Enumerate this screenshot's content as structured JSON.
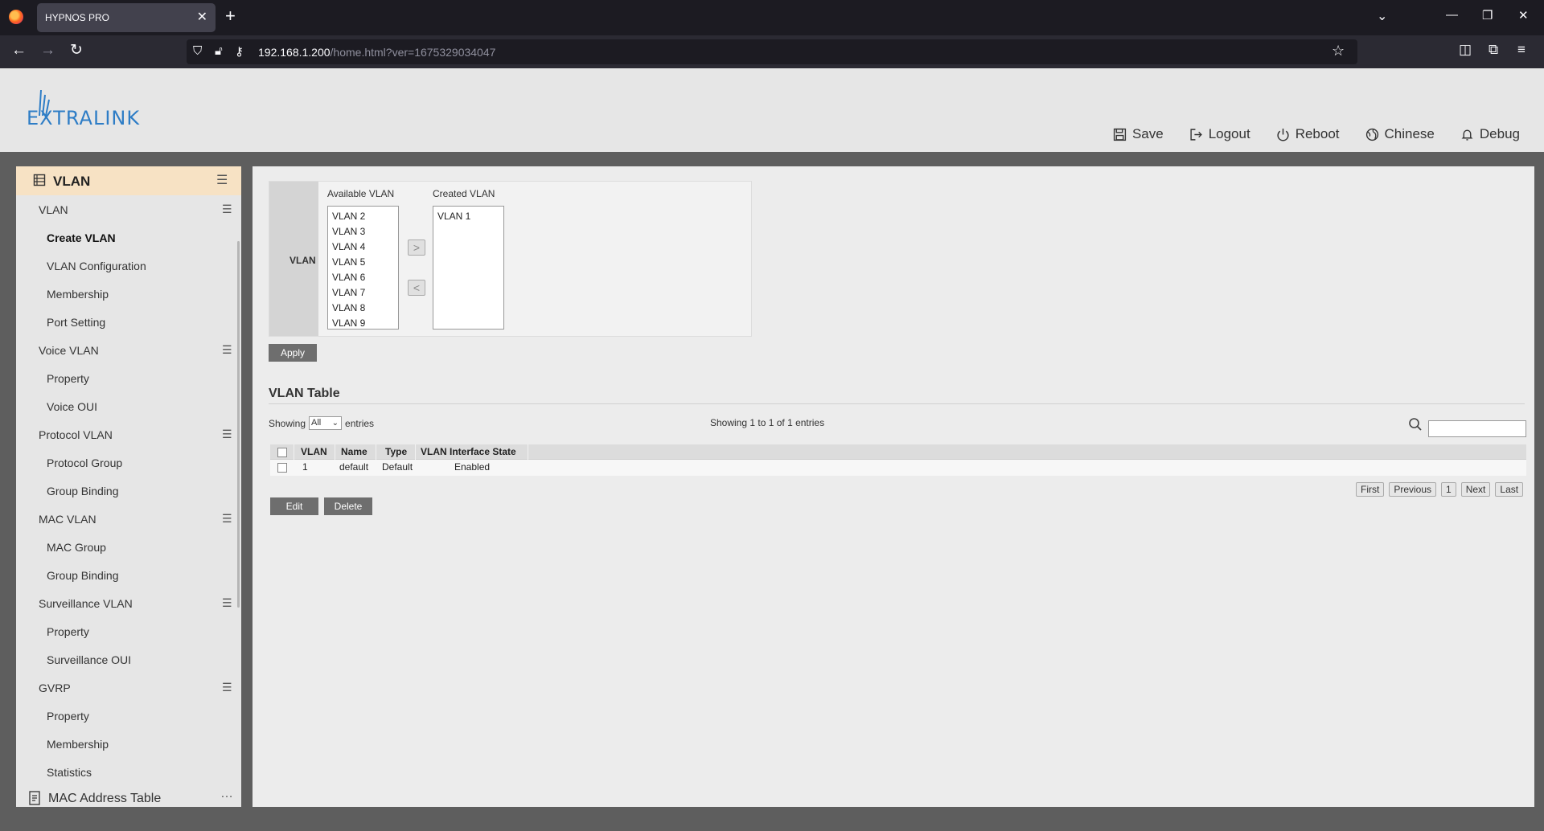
{
  "browser": {
    "tab_title": "HYPNOS PRO",
    "url_host": "192.168.1.200",
    "url_path": "/home.html?ver=1675329034047"
  },
  "header": {
    "logo_text": "EXTRALINK",
    "menu": [
      {
        "label": "Save",
        "icon": "save-icon"
      },
      {
        "label": "Logout",
        "icon": "logout-icon"
      },
      {
        "label": "Reboot",
        "icon": "power-icon"
      },
      {
        "label": "Chinese",
        "icon": "globe-icon"
      },
      {
        "label": "Debug",
        "icon": "bell-icon"
      }
    ]
  },
  "sidebar": {
    "title": "VLAN",
    "items": [
      {
        "label": "VLAN",
        "type": "group"
      },
      {
        "label": "Create VLAN",
        "type": "sub",
        "active": true
      },
      {
        "label": "VLAN Configuration",
        "type": "sub"
      },
      {
        "label": "Membership",
        "type": "sub"
      },
      {
        "label": "Port Setting",
        "type": "sub"
      },
      {
        "label": "Voice VLAN",
        "type": "group"
      },
      {
        "label": "Property",
        "type": "sub"
      },
      {
        "label": "Voice OUI",
        "type": "sub"
      },
      {
        "label": "Protocol VLAN",
        "type": "group"
      },
      {
        "label": "Protocol Group",
        "type": "sub"
      },
      {
        "label": "Group Binding",
        "type": "sub"
      },
      {
        "label": "MAC VLAN",
        "type": "group"
      },
      {
        "label": "MAC Group",
        "type": "sub"
      },
      {
        "label": "Group Binding",
        "type": "sub"
      },
      {
        "label": "Surveillance VLAN",
        "type": "group"
      },
      {
        "label": "Property",
        "type": "sub"
      },
      {
        "label": "Surveillance OUI",
        "type": "sub"
      },
      {
        "label": "GVRP",
        "type": "group"
      },
      {
        "label": "Property",
        "type": "sub"
      },
      {
        "label": "Membership",
        "type": "sub"
      },
      {
        "label": "Statistics",
        "type": "sub"
      }
    ],
    "bottom_section": "MAC Address Table"
  },
  "vlan_form": {
    "row_label": "VLAN",
    "available_title": "Available VLAN",
    "created_title": "Created VLAN",
    "available": [
      "VLAN 2",
      "VLAN 3",
      "VLAN 4",
      "VLAN 5",
      "VLAN 6",
      "VLAN 7",
      "VLAN 8",
      "VLAN 9"
    ],
    "created": [
      "VLAN 1"
    ],
    "add_arrow": ">",
    "remove_arrow": "<",
    "apply_label": "Apply"
  },
  "vlan_table": {
    "title": "VLAN Table",
    "showing_prefix": "Showing",
    "showing_select": "All",
    "showing_suffix": "entries",
    "showing_count": "Showing 1 to 1 of 1 entries",
    "columns": [
      "VLAN",
      "Name",
      "Type",
      "VLAN Interface State"
    ],
    "rows": [
      {
        "vlan": "1",
        "name": "default",
        "type": "Default",
        "state": "Enabled"
      }
    ],
    "edit_label": "Edit",
    "delete_label": "Delete",
    "pager": {
      "first": "First",
      "previous": "Previous",
      "page": "1",
      "next": "Next",
      "last": "Last"
    }
  }
}
